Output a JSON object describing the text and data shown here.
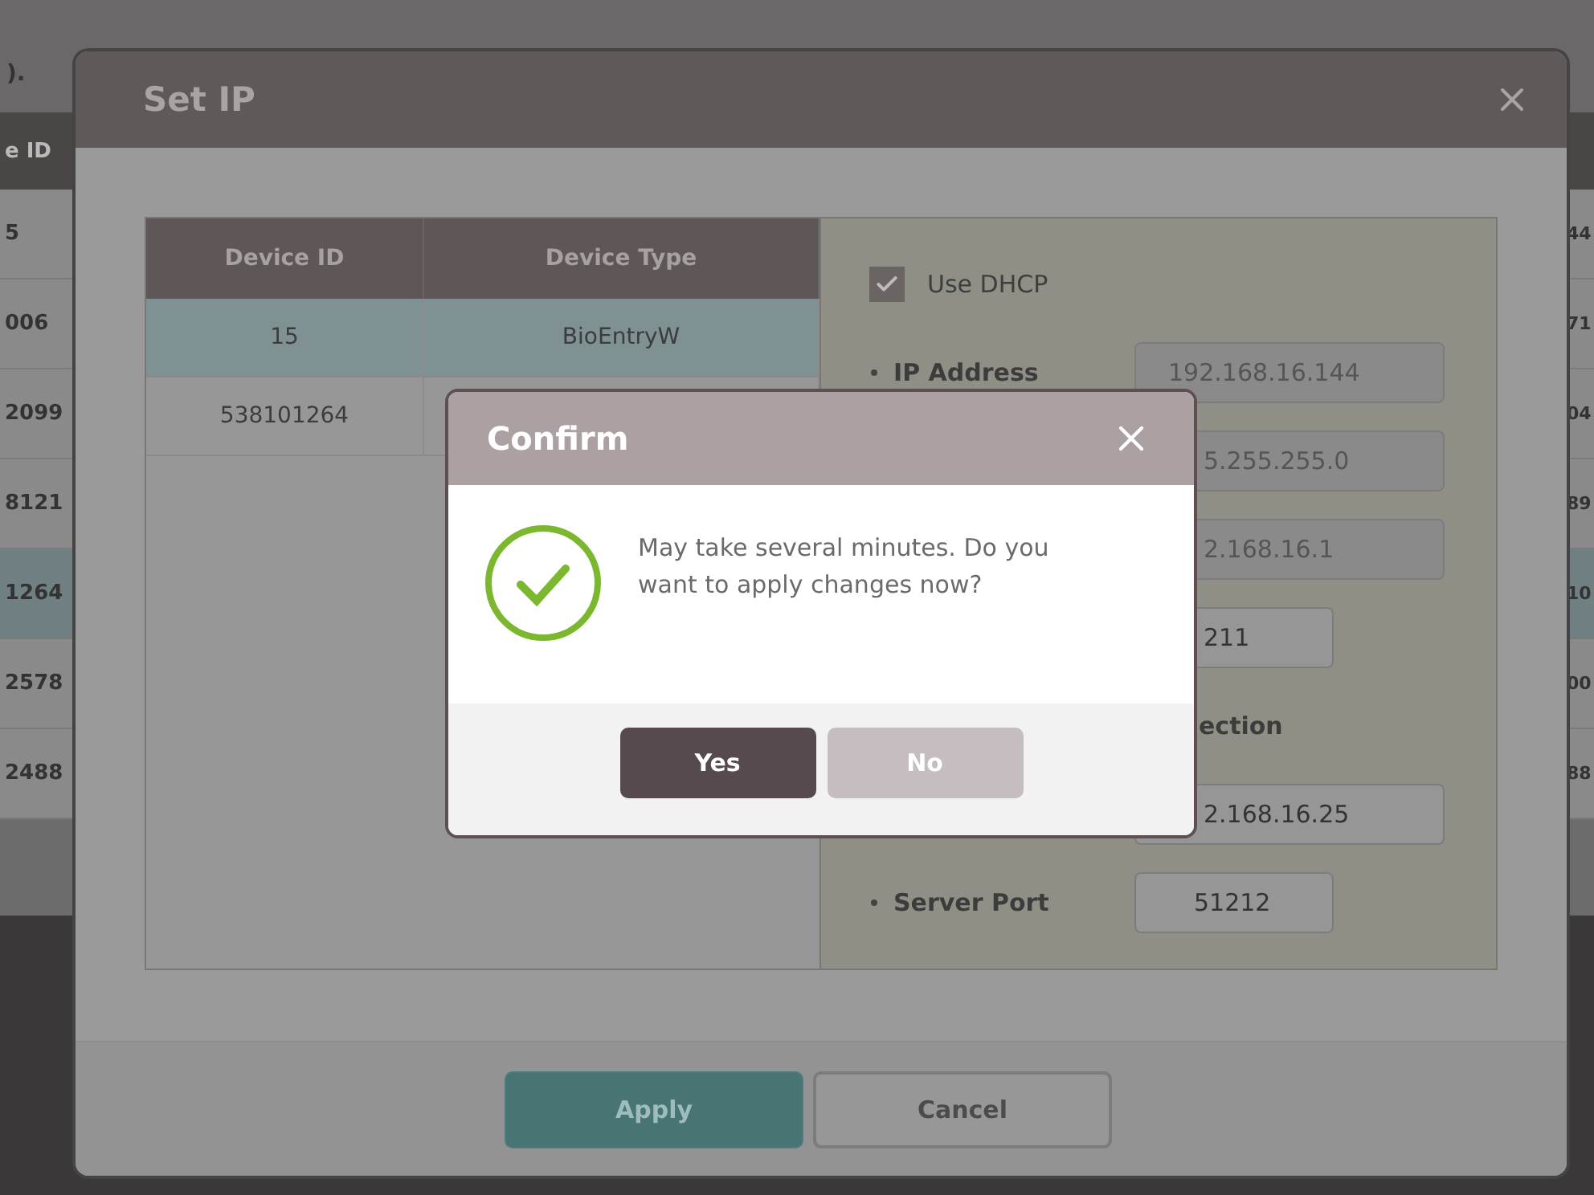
{
  "background_page": {
    "note_text": ").",
    "header": "e ID",
    "rows": [
      {
        "cells": [
          "5",
          "44"
        ],
        "selected": false
      },
      {
        "cells": [
          "006",
          "71"
        ],
        "selected": false
      },
      {
        "cells": [
          "2099",
          "04"
        ],
        "selected": false
      },
      {
        "cells": [
          "8121",
          "89"
        ],
        "selected": false
      },
      {
        "cells": [
          "1264",
          "10"
        ],
        "selected": true
      },
      {
        "cells": [
          "2578",
          "00"
        ],
        "selected": false
      },
      {
        "cells": [
          "2488",
          "88"
        ],
        "selected": false
      }
    ]
  },
  "set_ip_dialog": {
    "title": "Set IP",
    "device_table": {
      "columns": [
        "Device ID",
        "Device Type"
      ],
      "rows": [
        {
          "cells": [
            "15",
            "BioEntryW"
          ],
          "selected": true
        },
        {
          "cells": [
            "538101264"
          ],
          "selected": false
        }
      ]
    },
    "use_dhcp": {
      "label": "Use DHCP",
      "checked": true
    },
    "settings": [
      {
        "kind": "address",
        "label": "IP Address",
        "value": "192.168.16.144",
        "disabled": true
      },
      {
        "kind": "address",
        "value": "5.255.255.0",
        "disabled": true
      },
      {
        "kind": "address",
        "value": "2.168.16.1",
        "disabled": true
      },
      {
        "kind": "port",
        "value": "211",
        "disabled": false
      },
      {
        "kind": "heading",
        "label": "ection"
      },
      {
        "kind": "address",
        "value": "2.168.16.25",
        "disabled": false
      },
      {
        "kind": "port",
        "label": "Server Port",
        "value": "51212",
        "disabled": false
      }
    ],
    "buttons": [
      {
        "label": "Apply",
        "kind": "primary"
      },
      {
        "label": "Cancel",
        "kind": "secondary"
      }
    ]
  },
  "confirm_dialog": {
    "title": "Confirm",
    "message": "May take several minutes. Do you want to apply changes now?",
    "buttons": [
      {
        "label": "Yes",
        "kind": "primary"
      },
      {
        "label": "No",
        "kind": "secondary"
      }
    ]
  }
}
